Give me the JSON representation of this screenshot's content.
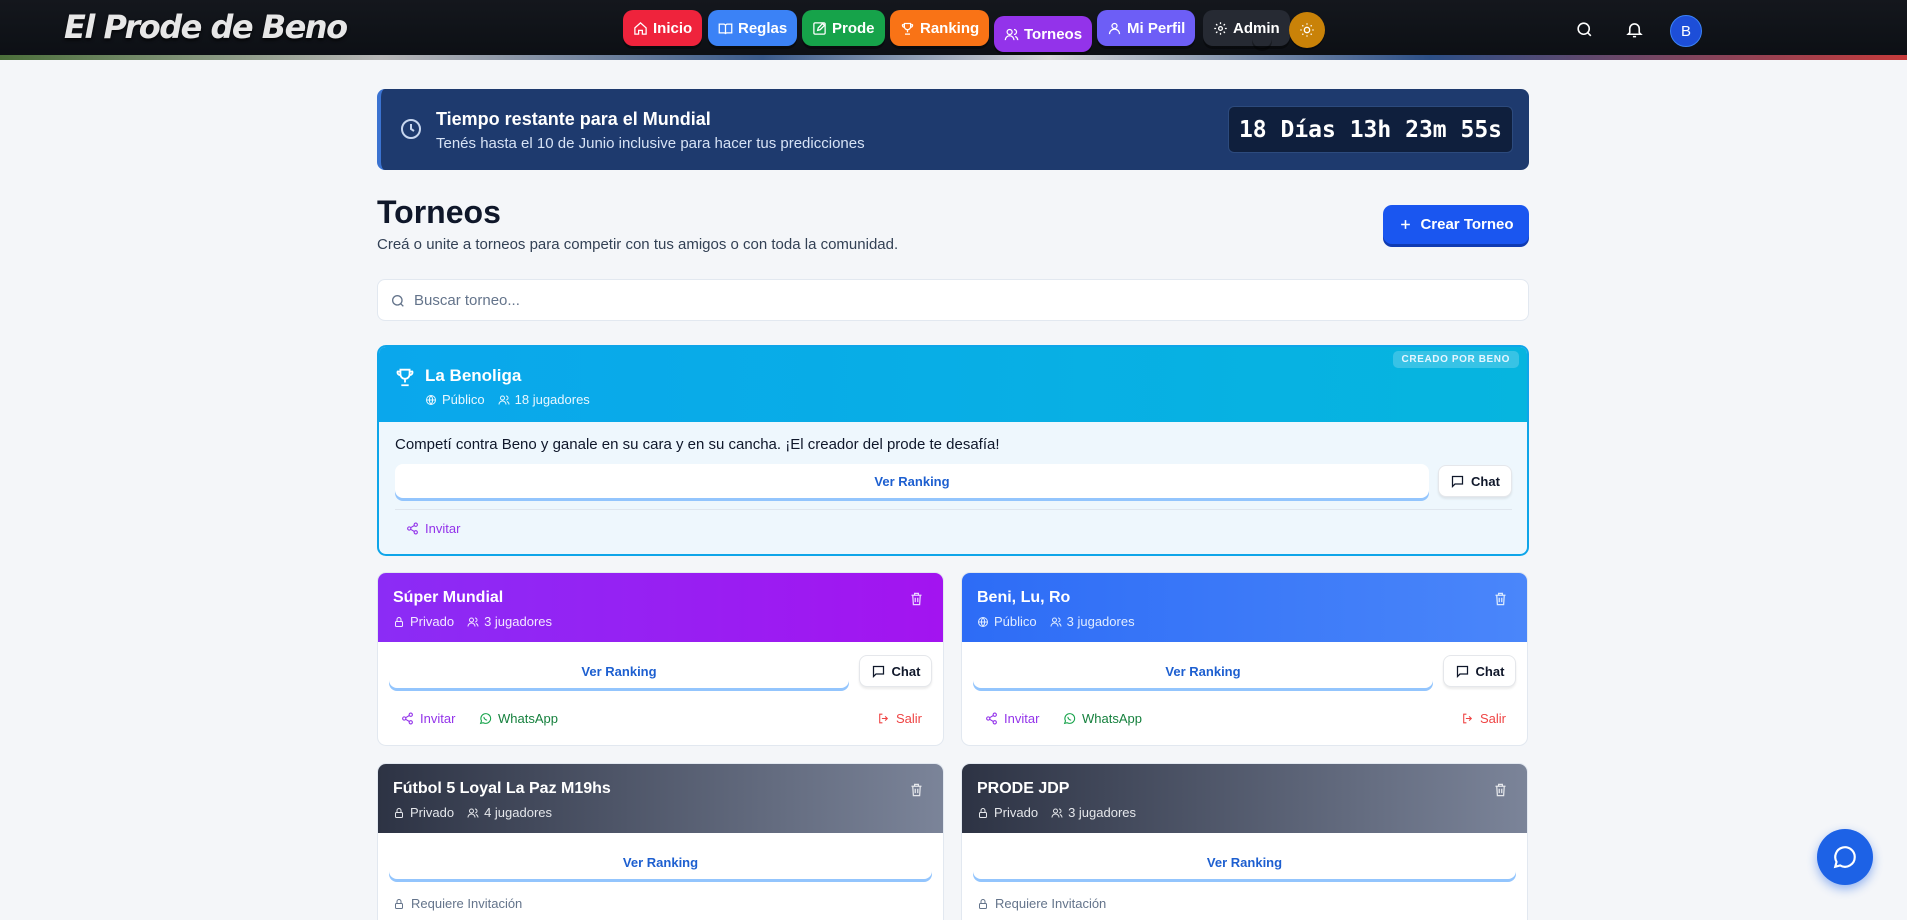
{
  "brand": "El Prode de Beno",
  "nav": {
    "items": [
      {
        "label": "Inicio",
        "icon": "home-icon",
        "color": "#ef233c"
      },
      {
        "label": "Reglas",
        "icon": "book-icon",
        "color": "#3b82f6"
      },
      {
        "label": "Prode",
        "icon": "edit-icon",
        "color": "#16a34a"
      },
      {
        "label": "Ranking",
        "icon": "trophy-icon",
        "color": "#f97316"
      },
      {
        "label": "Torneos",
        "icon": "users-icon",
        "color": "#9333ea"
      },
      {
        "label": "Mi Perfil",
        "icon": "user-icon",
        "color": "#6d5ef6"
      },
      {
        "label": "Admin",
        "icon": "gear-icon",
        "color": "#262a33"
      }
    ],
    "avatar_initial": "B"
  },
  "countdown": {
    "title": "Tiempo restante para el Mundial",
    "subtitle": "Tenés hasta el 10 de Junio inclusive para hacer tus predicciones",
    "timer": "18 Días 13h 23m 55s"
  },
  "page": {
    "title": "Torneos",
    "subtitle": "Creá o unite a torneos para competir con tus amigos o con toda la comunidad.",
    "create_button": "Crear Torneo",
    "search_placeholder": "Buscar torneo..."
  },
  "featured": {
    "badge": "CREADO POR BENO",
    "name": "La Benoliga",
    "visibility": "Público",
    "players": "18 jugadores",
    "description": "Competí contra Beno y ganale en su cara y en su cancha. ¡El creador del prode te desafía!",
    "ranking_button": "Ver Ranking",
    "chat_button": "Chat",
    "invite": "Invitar"
  },
  "tournaments": [
    {
      "name": "Súper Mundial",
      "visibility": "Privado",
      "players": "3 jugadores",
      "ranking_button": "Ver Ranking",
      "chat_button": "Chat",
      "invite": "Invitar",
      "whatsapp": "WhatsApp",
      "leave": "Salir",
      "colors": [
        "#8b2cf5",
        "#a314f0"
      ]
    },
    {
      "name": "Beni, Lu, Ro",
      "visibility": "Público",
      "players": "3 jugadores",
      "ranking_button": "Ver Ranking",
      "chat_button": "Chat",
      "invite": "Invitar",
      "whatsapp": "WhatsApp",
      "leave": "Salir",
      "colors": [
        "#2d6cf6",
        "#4a86fa"
      ]
    },
    {
      "name": "Fútbol 5 Loyal La Paz M19hs",
      "visibility": "Privado",
      "players": "4 jugadores",
      "ranking_button": "Ver Ranking",
      "requires": "Requiere Invitación",
      "colors": [
        "#2d3344",
        "#7b8499"
      ]
    },
    {
      "name": "PRODE JDP",
      "visibility": "Privado",
      "players": "3 jugadores",
      "ranking_button": "Ver Ranking",
      "requires": "Requiere Invitación",
      "colors": [
        "#2d3344",
        "#7b8499"
      ]
    }
  ]
}
